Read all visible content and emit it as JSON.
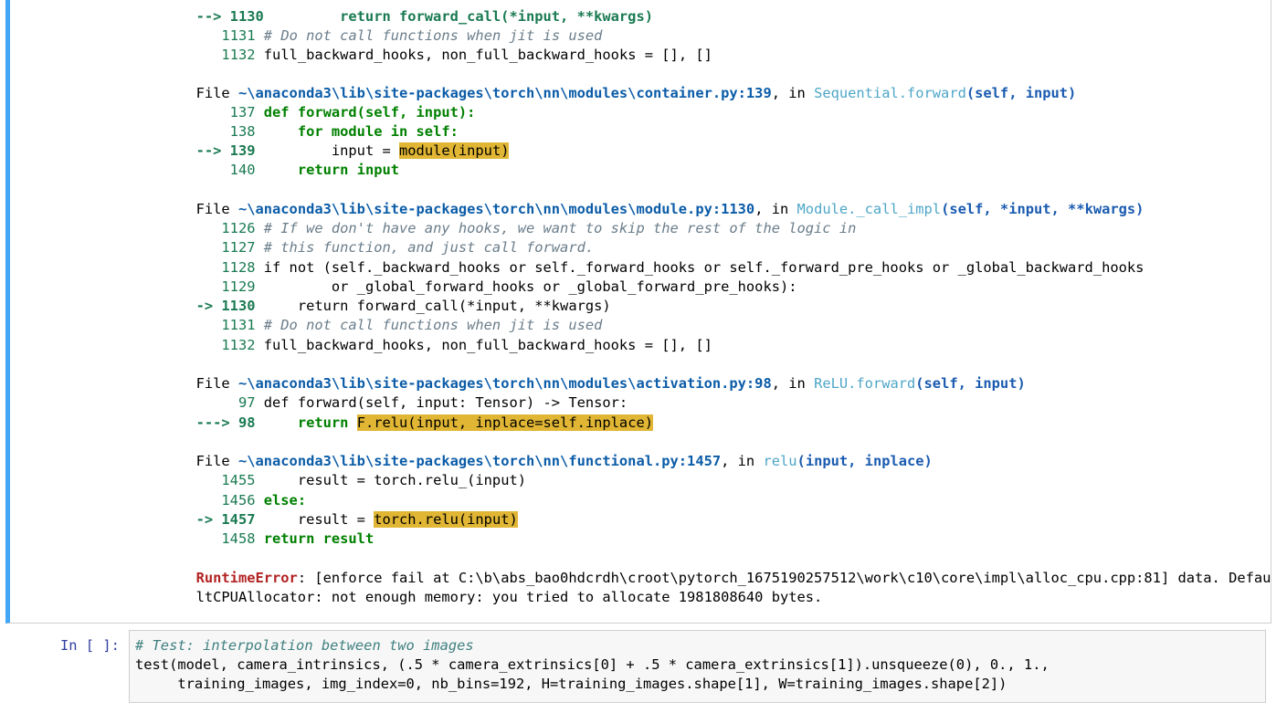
{
  "traceback": {
    "top_block": {
      "line_cut": "--> 1130         return forward_call(*input, **kwargs)",
      "l1131": {
        "num": "1131",
        "text": "# Do not call functions when jit is used"
      },
      "l1132": {
        "num": "1132",
        "text": "full_backward_hooks, non_full_backward_hooks = [], []"
      }
    },
    "frame_container": {
      "file_prefix": "File ",
      "path": "~\\anaconda3\\lib\\site-packages\\torch\\nn\\modules\\container.py:139",
      "in": ", in ",
      "func": "Sequential.forward",
      "args": "(self, input)",
      "lines": [
        {
          "gutter": "    137 ",
          "code": "def forward(self, input):"
        },
        {
          "gutter": "    138 ",
          "code": "    for module in self:"
        },
        {
          "gutter": "--> 139 ",
          "code_pre": "        input = ",
          "code_hl": "module(input)"
        },
        {
          "gutter": "    140 ",
          "code": "    return input"
        }
      ]
    },
    "frame_module": {
      "file_prefix": "File ",
      "path": "~\\anaconda3\\lib\\site-packages\\torch\\nn\\modules\\module.py:1130",
      "in": ", in ",
      "func": "Module._call_impl",
      "args": "(self, *input, **kwargs)",
      "lines": [
        {
          "gutter": "   1126 ",
          "code": "# If we don't have any hooks, we want to skip the rest of the logic in"
        },
        {
          "gutter": "   1127 ",
          "code": "# this function, and just call forward."
        },
        {
          "gutter": "   1128 ",
          "code": "if not (self._backward_hooks or self._forward_hooks or self._forward_pre_hooks or _global_backward_hooks"
        },
        {
          "gutter": "   1129 ",
          "code": "        or _global_forward_hooks or _global_forward_pre_hooks):"
        },
        {
          "gutter": "-> 1130 ",
          "code": "    return forward_call(*input, **kwargs)"
        },
        {
          "gutter": "   1131 ",
          "code": "# Do not call functions when jit is used"
        },
        {
          "gutter": "   1132 ",
          "code": "full_backward_hooks, non_full_backward_hooks = [], []"
        }
      ]
    },
    "frame_activation": {
      "file_prefix": "File ",
      "path": "~\\anaconda3\\lib\\site-packages\\torch\\nn\\modules\\activation.py:98",
      "in": ", in ",
      "func": "ReLU.forward",
      "args": "(self, input)",
      "lines": [
        {
          "gutter": "     97 ",
          "code": "def forward(self, input: Tensor) -> Tensor:"
        },
        {
          "gutter": "---> 98 ",
          "code_pre": "    return ",
          "code_hl": "F.relu(input, inplace=self.inplace)"
        }
      ]
    },
    "frame_functional": {
      "file_prefix": "File ",
      "path": "~\\anaconda3\\lib\\site-packages\\torch\\nn\\functional.py:1457",
      "in": ", in ",
      "func": "relu",
      "args": "(input, inplace)",
      "lines": [
        {
          "gutter": "   1455 ",
          "code": "    result = torch.relu_(input)"
        },
        {
          "gutter": "   1456 ",
          "code": "else:"
        },
        {
          "gutter": "-> 1457 ",
          "code_pre": "    result = ",
          "code_hl": "torch.relu(input)"
        },
        {
          "gutter": "   1458 ",
          "code": "return result"
        }
      ]
    },
    "error": {
      "name": "RuntimeError",
      "line1": ": [enforce fail at C:\\b\\abs_bao0hdcrdh\\croot\\pytorch_1675190257512\\work\\c10\\core\\impl\\alloc_cpu.cpp:81] data. Defau",
      "line2": "ltCPUAllocator: not enough memory: you tried to allocate 1981808640 bytes."
    }
  },
  "input_cell": {
    "prompt": "In [ ]:",
    "comment": "# Test: interpolation between two images",
    "line2": "test(model, camera_intrinsics, (.5 * camera_extrinsics[0] + .5 * camera_extrinsics[1]).unsqueeze(0), 0., 1.,",
    "line3": "     training_images, img_index=0, nb_bins=192, H=training_images.shape[1], W=training_images.shape[2])"
  },
  "colors": {
    "cell_border_accent": "#42a5f5",
    "highlight": "#e0b634",
    "error": "#b22222"
  }
}
